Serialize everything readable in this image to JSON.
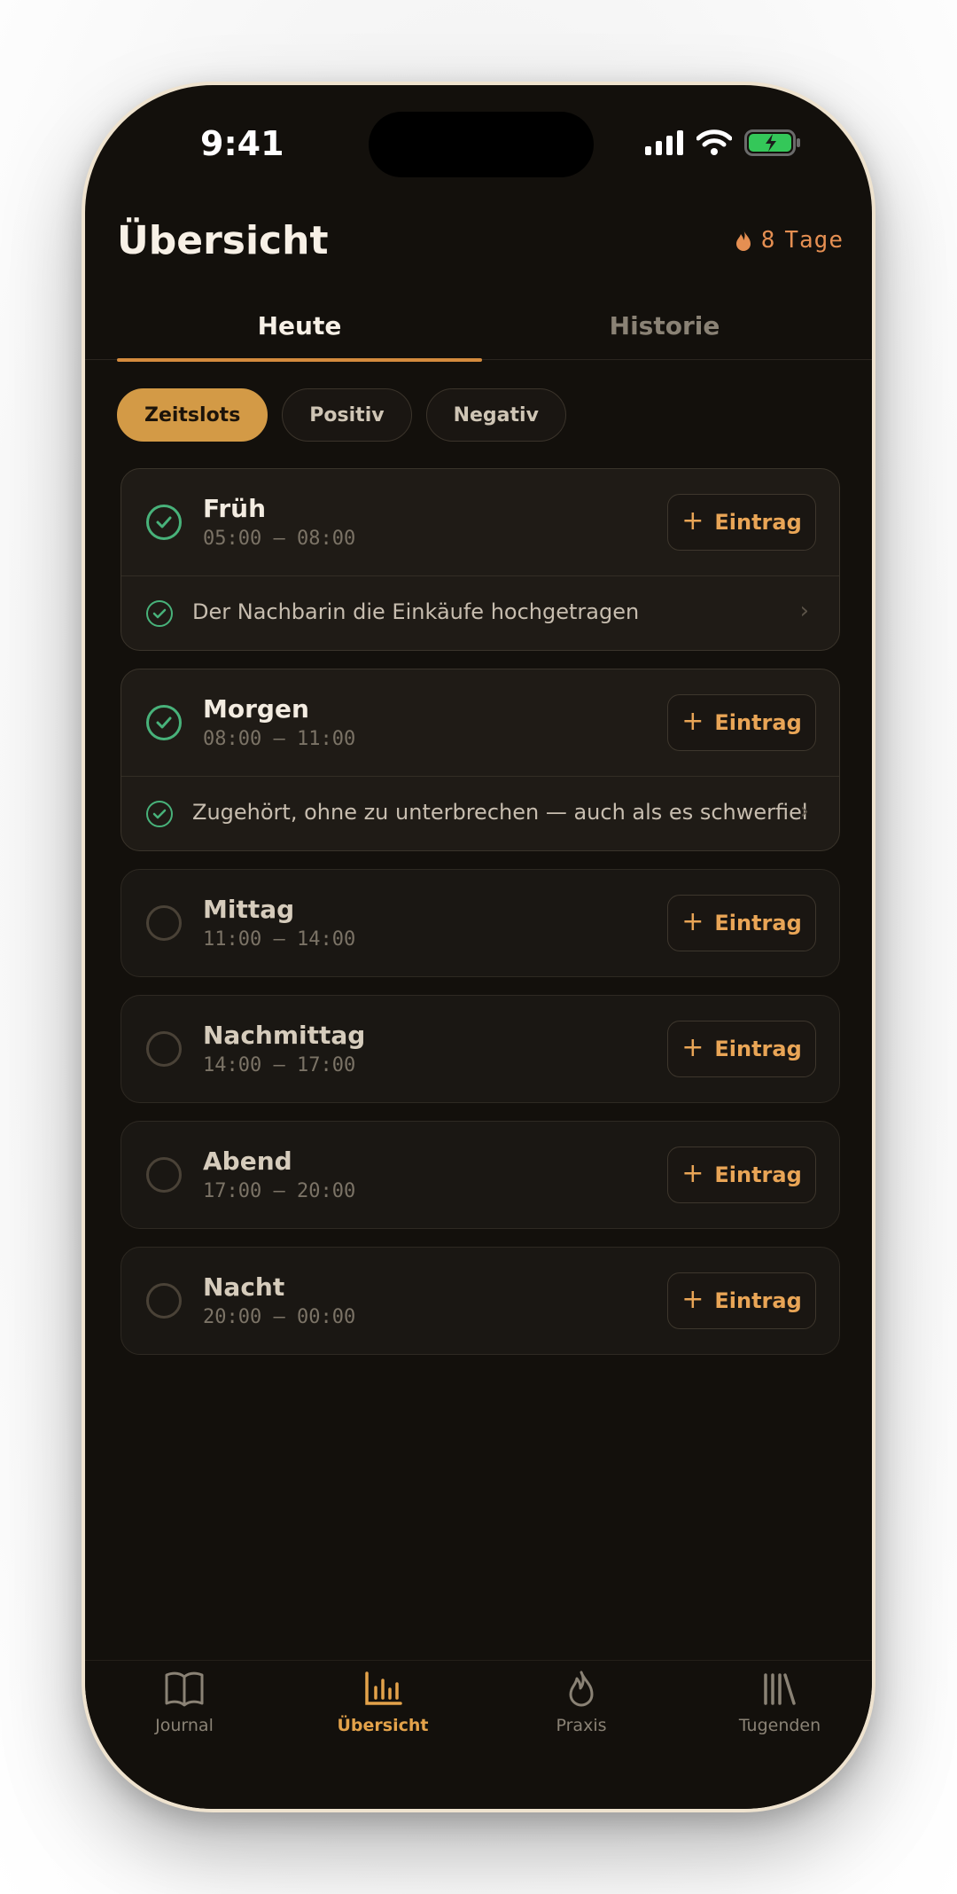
{
  "status_bar": {
    "time": "9:41"
  },
  "header": {
    "title": "Übersicht",
    "streak_count": "8",
    "streak_unit": "Tage",
    "streak_icon": "flame-icon"
  },
  "tabs": [
    {
      "label": "Heute",
      "active": true
    },
    {
      "label": "Historie",
      "active": false
    }
  ],
  "filters": [
    {
      "label": "Zeitslots",
      "active": true
    },
    {
      "label": "Positiv",
      "active": false
    },
    {
      "label": "Negativ",
      "active": false
    }
  ],
  "slots": [
    {
      "name": "Früh",
      "time": "05:00 – 08:00",
      "done": true,
      "add_label": "Eintrag",
      "entry": "Der Nachbarin die Einkäufe hochgetragen"
    },
    {
      "name": "Morgen",
      "time": "08:00 – 11:00",
      "done": true,
      "add_label": "Eintrag",
      "entry": "Zugehört, ohne zu unterbrechen — auch als es schwerfiel"
    },
    {
      "name": "Mittag",
      "time": "11:00 – 14:00",
      "done": false,
      "add_label": "Eintrag"
    },
    {
      "name": "Nachmittag",
      "time": "14:00 – 17:00",
      "done": false,
      "add_label": "Eintrag"
    },
    {
      "name": "Abend",
      "time": "17:00 – 20:00",
      "done": false,
      "add_label": "Eintrag"
    },
    {
      "name": "Nacht",
      "time": "20:00 – 00:00",
      "done": false,
      "add_label": "Eintrag"
    }
  ],
  "tabbar": [
    {
      "label": "Journal",
      "icon": "book-icon",
      "active": false
    },
    {
      "label": "Übersicht",
      "icon": "bar-chart-icon",
      "active": true
    },
    {
      "label": "Praxis",
      "icon": "flame-icon",
      "active": false
    },
    {
      "label": "Tugenden",
      "icon": "library-icon",
      "active": false
    }
  ],
  "colors": {
    "accent": "#d39a46",
    "check_green": "#48b27a",
    "streak": "#e58f52",
    "background": "#13100c"
  }
}
